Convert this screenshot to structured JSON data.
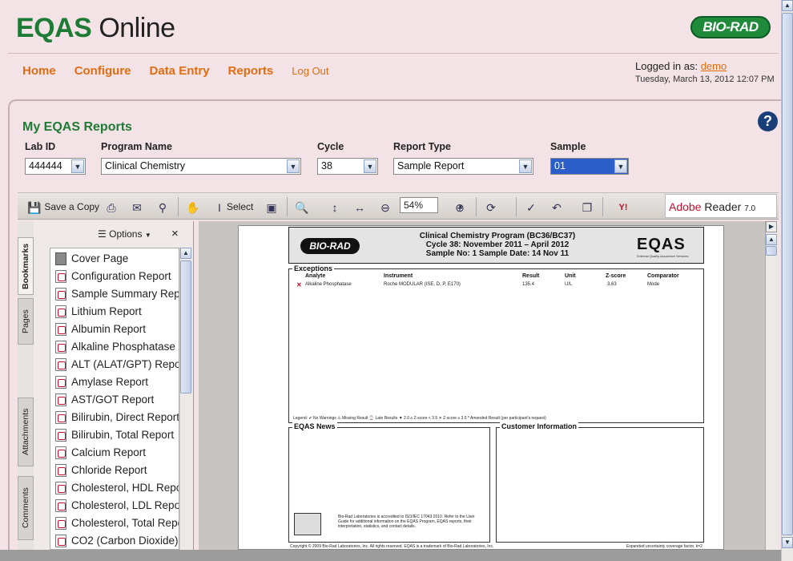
{
  "header": {
    "logo_bold": "EQAS",
    "logo_rest": "Online",
    "brand": "BIO-RAD",
    "nav": [
      "Home",
      "Configure",
      "Data Entry",
      "Reports"
    ],
    "logout": "Log Out",
    "logged_in_label": "Logged in as:",
    "user": "demo",
    "datetime": "Tuesday, March 13, 2012 12:07 PM"
  },
  "panel": {
    "title": "My EQAS Reports",
    "help": "?",
    "filters": [
      {
        "label": "Lab ID",
        "value": "444444"
      },
      {
        "label": "Program Name",
        "value": "Clinical Chemistry"
      },
      {
        "label": "Cycle",
        "value": "38"
      },
      {
        "label": "Report Type",
        "value": "Sample Report"
      },
      {
        "label": "Sample",
        "value": "01"
      }
    ]
  },
  "toolbar": {
    "save_copy": "Save a Copy",
    "select": "Select",
    "zoom": "54%",
    "adobe_brand": "Adobe",
    "adobe_product": "Reader",
    "adobe_version": "7.0"
  },
  "bookmarks": {
    "options": "Options",
    "close": "×",
    "tabs": [
      "Bookmarks",
      "Pages",
      "Attachments",
      "Comments"
    ],
    "items": [
      "Cover Page",
      "Configuration Report",
      "Sample Summary Report",
      "Lithium Report",
      "Albumin Report",
      "Alkaline Phosphatase Report",
      "ALT (ALAT/GPT) Report",
      "Amylase Report",
      "AST/GOT Report",
      "Bilirubin, Direct Report",
      "Bilirubin, Total Report",
      "Calcium Report",
      "Chloride Report",
      "Cholesterol, HDL Report",
      "Cholesterol, LDL Report",
      "Cholesterol, Total Report",
      "CO2 (Carbon Dioxide) Report"
    ]
  },
  "report": {
    "brand": "BIO-RAD",
    "eqas": "EQAS",
    "eqas_sub": "External Quality Assurance Services",
    "title_line1": "Clinical Chemistry Program (BC36/BC37)",
    "title_line2": "Cycle 38: November 2011 – April 2012",
    "title_line3": "Sample No: 1  Sample Date: 14 Nov 11",
    "exceptions_label": "Exceptions",
    "columns": [
      "Analyte",
      "Instrument",
      "Result",
      "Unit",
      "Z-score",
      "Comparator"
    ],
    "rows": [
      {
        "mark": "✕",
        "analyte": "Alkaline Phosphatase",
        "instrument": "Roche MODULAR (ISE, D, P, E170)",
        "result": "135.4",
        "unit": "U/L",
        "zscore": "3.63",
        "comparator": "Mode"
      }
    ],
    "legend": "Legend:  ✔ No Warnings   ⚠ Missing Result   ⌚ Late Results   ▼ 2.0 ≤ Z-score < 3.5   ✕ Z-score ≥ 3.5   * Amended Result (per participant's request)",
    "news_label": "EQAS News",
    "customer_label": "Customer Information",
    "accred": "Bio-Rad Laboratories is accredited to ISO/IEC 17043:2010. Refer to the User Guide for additional information on the EQAS Program, EQAS reports, their interpretation, statistics, and contact details.",
    "copyright": "Copyright © 2009 Bio-Rad Laboratories, Inc.  All rights reserved.  EQAS is a trademark of Bio-Rad Laboratories, Inc.",
    "footer_right": "Expanded uncertainty coverage factor, k=2"
  }
}
